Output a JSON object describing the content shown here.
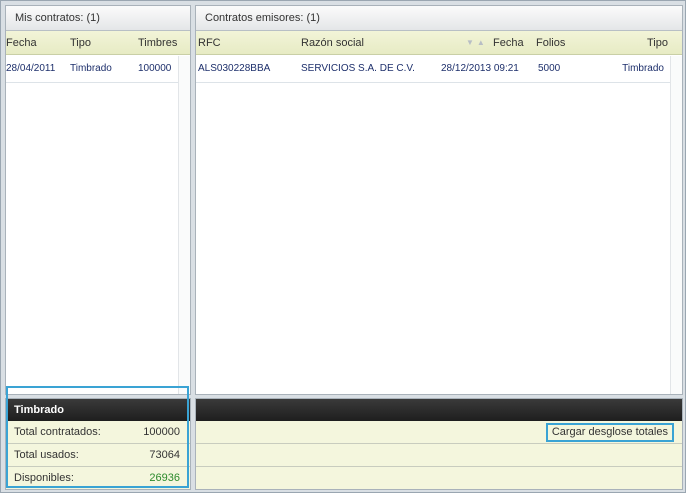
{
  "left_panel": {
    "title": "Mis contratos: (1)",
    "columns": [
      "Fecha",
      "Tipo",
      "Timbres"
    ],
    "rows": [
      {
        "fecha": "28/04/2011",
        "tipo": "Timbrado",
        "timbres": "100000"
      }
    ]
  },
  "right_panel": {
    "title": "Contratos emisores: (1)",
    "columns": [
      "RFC",
      "Razón social",
      "Fecha",
      "Folios",
      "Tipo"
    ],
    "rows": [
      {
        "rfc": "ALS030228BBA",
        "razon_social": "SERVICIOS S.A. DE C.V.",
        "fecha": "28/12/2013 09:21",
        "folios": "5000",
        "tipo": "Timbrado"
      }
    ]
  },
  "summary": {
    "header": "Timbrado",
    "total_contratados_label": "Total contratados:",
    "total_contratados_value": "100000",
    "total_usados_label": "Total usados:",
    "total_usados_value": "73064",
    "disponibles_label": "Disponibles:",
    "disponibles_value": "26936",
    "cargar_button": "Cargar desglose totales"
  },
  "icons": {
    "sort": "sort-arrows-icon"
  },
  "colors": {
    "dark_bar": "#1e1e1e",
    "highlight": "#3aa3d4",
    "available_value": "#2c8a2c",
    "row_text": "#1d2f6b"
  }
}
